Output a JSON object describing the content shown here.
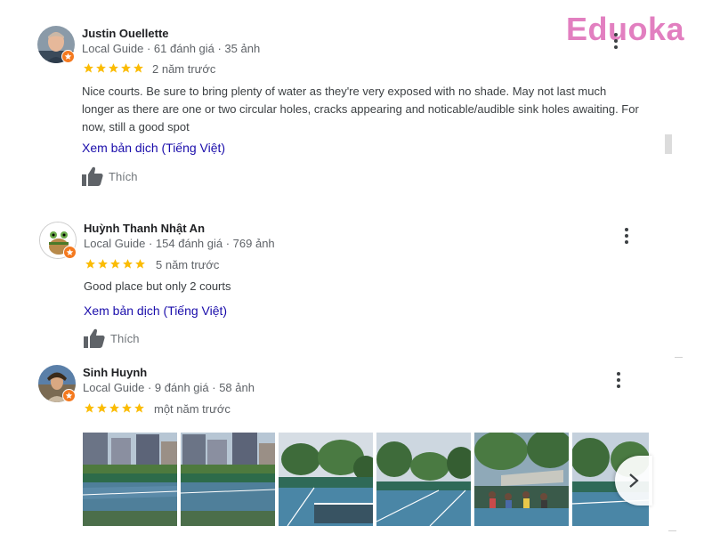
{
  "watermark": {
    "logo_text": "Eduoka"
  },
  "reviews": [
    {
      "author": "Justin Ouellette",
      "meta": "Local Guide · 61 đánh giá · 35 ảnh",
      "rating": 5,
      "time": "2 năm trước",
      "text": "Nice courts. Be sure to bring plenty of water as they're very exposed with no shade. May not last much longer as there are one or two circular holes, cracks appearing and noticable/audible  sink holes awaiting. For now, still a good spot",
      "translate_label": "Xem bản dịch (Tiếng Việt)",
      "like_label": "Thích"
    },
    {
      "author": "Huỳnh Thanh Nhật An",
      "meta": "Local Guide · 154 đánh giá · 769 ảnh",
      "rating": 5,
      "time": "5 năm trước",
      "text": "Good place but only 2 courts",
      "translate_label": "Xem bản dịch (Tiếng Việt)",
      "like_label": "Thích"
    },
    {
      "author": "Sinh Huynh",
      "meta": "Local Guide · 9 đánh giá · 58 ảnh",
      "rating": 5,
      "time": "một năm trước",
      "photo_count_visible": 6
    }
  ],
  "colors": {
    "star": "#fbbc04",
    "link": "#1a0dab",
    "badge": "#f4791f",
    "logo": "#e27fc0"
  },
  "icons": [
    "star-icon",
    "thumbs-up-icon",
    "more-vert-icon",
    "chevron-right-icon",
    "local-guide-badge-icon"
  ]
}
